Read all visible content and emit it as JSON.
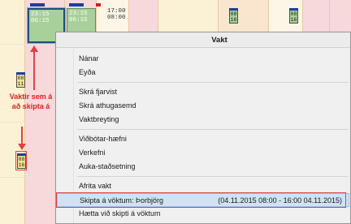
{
  "schedule": {
    "shifts": [
      {
        "line1": "23:15",
        "line2": "06:15"
      },
      {
        "line1": "23:15",
        "line2": "06:15"
      },
      {
        "line1": "17:00",
        "line2": "08:00"
      }
    ],
    "mini_blocks": [
      {
        "line1": "08",
        "line2": "16"
      },
      {
        "line1": "08",
        "line2": "16"
      },
      {
        "line1": "08",
        "line2": "11"
      },
      {
        "line1": "08",
        "line2": "16"
      }
    ],
    "annotation": "Vaktir sem á að skipta á"
  },
  "context_menu": {
    "title": "Vakt",
    "groups": [
      [
        "Nánar",
        "Eyða"
      ],
      [
        "Skrá fjarvist",
        "Skrá athugasemd",
        "Vaktbreyting"
      ],
      [
        "Viðbótar-hæfni",
        "Verkefni",
        "Auka-staðsetning"
      ],
      [
        "Afrita vakt"
      ]
    ],
    "swap_item": {
      "label": "Skipta á vöktum: Þorbjörg",
      "detail": "(04.11.2015 08:00 - 16:00 04.11.2015)"
    },
    "cancel_swap_item": "Hætta við skipti á vöktum"
  },
  "colors": {
    "highlight": "#cde3f7",
    "annotation_red": "#e04040",
    "shift_green": "#a8d09a",
    "flag_blue": "#1b3fa3"
  }
}
